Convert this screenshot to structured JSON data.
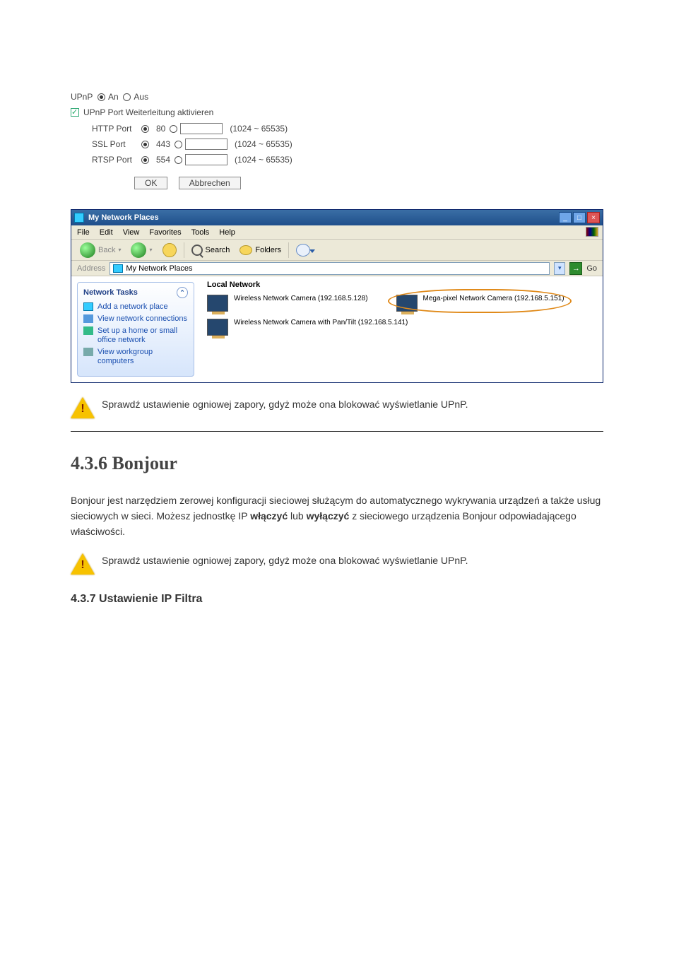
{
  "settings": {
    "upnp_label": "UPnP",
    "on_label": "An",
    "off_label": "Aus",
    "fwd_checkbox": "UPnP Port Weiterleitung aktivieren",
    "ports": [
      {
        "name": "HTTP Port",
        "default": "80",
        "range": "(1024 ~ 65535)"
      },
      {
        "name": "SSL Port",
        "default": "443",
        "range": "(1024 ~ 65535)"
      },
      {
        "name": "RTSP Port",
        "default": "554",
        "range": "(1024 ~ 65535)"
      }
    ],
    "ok": "OK",
    "cancel": "Abbrechen"
  },
  "explorer": {
    "title": "My Network Places",
    "menu": [
      "File",
      "Edit",
      "View",
      "Favorites",
      "Tools",
      "Help"
    ],
    "back": "Back",
    "search": "Search",
    "folders": "Folders",
    "address_label": "Address",
    "address_value": "My Network Places",
    "go": "Go",
    "side_header": "Network Tasks",
    "side_items": [
      "Add a network place",
      "View network connections",
      "Set up a home or small office network",
      "View workgroup computers"
    ],
    "main_header": "Local Network",
    "devices": [
      {
        "label": "Wireless Network Camera (192.168.5.128)"
      },
      {
        "label": "Mega-pixel Network Camera (192.168.5.151)"
      },
      {
        "label": "Wireless Network Camera with Pan/Tilt (192.168.5.141)"
      }
    ]
  },
  "warn1": "Sprawdź ustawienie ogniowej zapory, gdyż może ona blokować wyświetlanie UPnP.",
  "section_title": "4.3.6 Bonjour",
  "section_para_pre": "Bonjour jest narzędziem zerowej konfiguracji sieciowej służącym do automatycznego wykrywania urządzeń a także usług sieciowych w sieci. Możesz jednostkę IP ",
  "section_para_bold": "włączyć",
  "section_para_mid": " lub ",
  "section_para_bold2": "wyłączyć",
  "section_para_post": " z sieciowego urządzenia Bonjour odpowiadającego właściwości.",
  "warn2": "Sprawdź ustawienie ogniowej zapory, gdyż może ona blokować wyświetlanie UPnP.",
  "sub_title": "4.3.7 Ustawienie IP Filtra"
}
